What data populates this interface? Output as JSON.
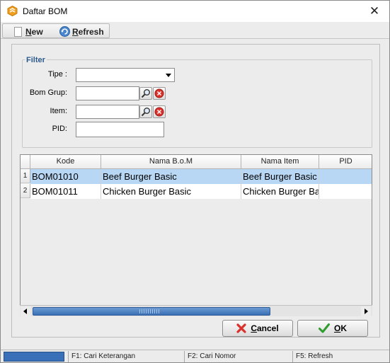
{
  "window": {
    "title": "Daftar BOM",
    "close_glyph": "✕"
  },
  "toolbar": {
    "new_mnemonic": "N",
    "new_rest": "ew",
    "refresh_mnemonic": "R",
    "refresh_rest": "efresh"
  },
  "filter": {
    "legend": "Filter",
    "tipe_label": "Tipe :",
    "tipe_value": "",
    "bom_grup_label": "Bom Grup:",
    "bom_grup_value": "",
    "item_label": "Item:",
    "item_value": "",
    "pid_label": "PID:",
    "pid_value": ""
  },
  "grid": {
    "columns": [
      "Kode",
      "Nama B.o.M",
      "Nama Item",
      "PID"
    ],
    "rows": [
      {
        "num": "1",
        "kode": "BOM01010",
        "nama_bom": "Beef Burger Basic",
        "nama_item": "Beef Burger Basic",
        "pid": "",
        "selected": true
      },
      {
        "num": "2",
        "kode": "BOM01011",
        "nama_bom": "Chicken Burger Basic",
        "nama_item": "Chicken Burger Basic",
        "pid": "",
        "selected": false
      }
    ]
  },
  "buttons": {
    "cancel_mnemonic": "C",
    "cancel_rest": "ancel",
    "ok_mnemonic": "O",
    "ok_rest": "K"
  },
  "statusbar": {
    "f1": "F1: Cari Keterangan",
    "f2": "F2: Cari Nomor",
    "f5": "F5: Refresh"
  },
  "icons": {
    "app": "bom-app-icon",
    "search": "magnifier-icon",
    "clear": "clear-red-icon",
    "refresh": "refresh-icon",
    "cancel": "red-x-icon",
    "ok": "green-check-icon"
  },
  "colors": {
    "selected_row": "#b8d7f4",
    "accent_blue": "#3970b8",
    "legend_blue": "#2c5a8c",
    "clear_red": "#d9312b",
    "ok_green": "#2e9c2e"
  }
}
